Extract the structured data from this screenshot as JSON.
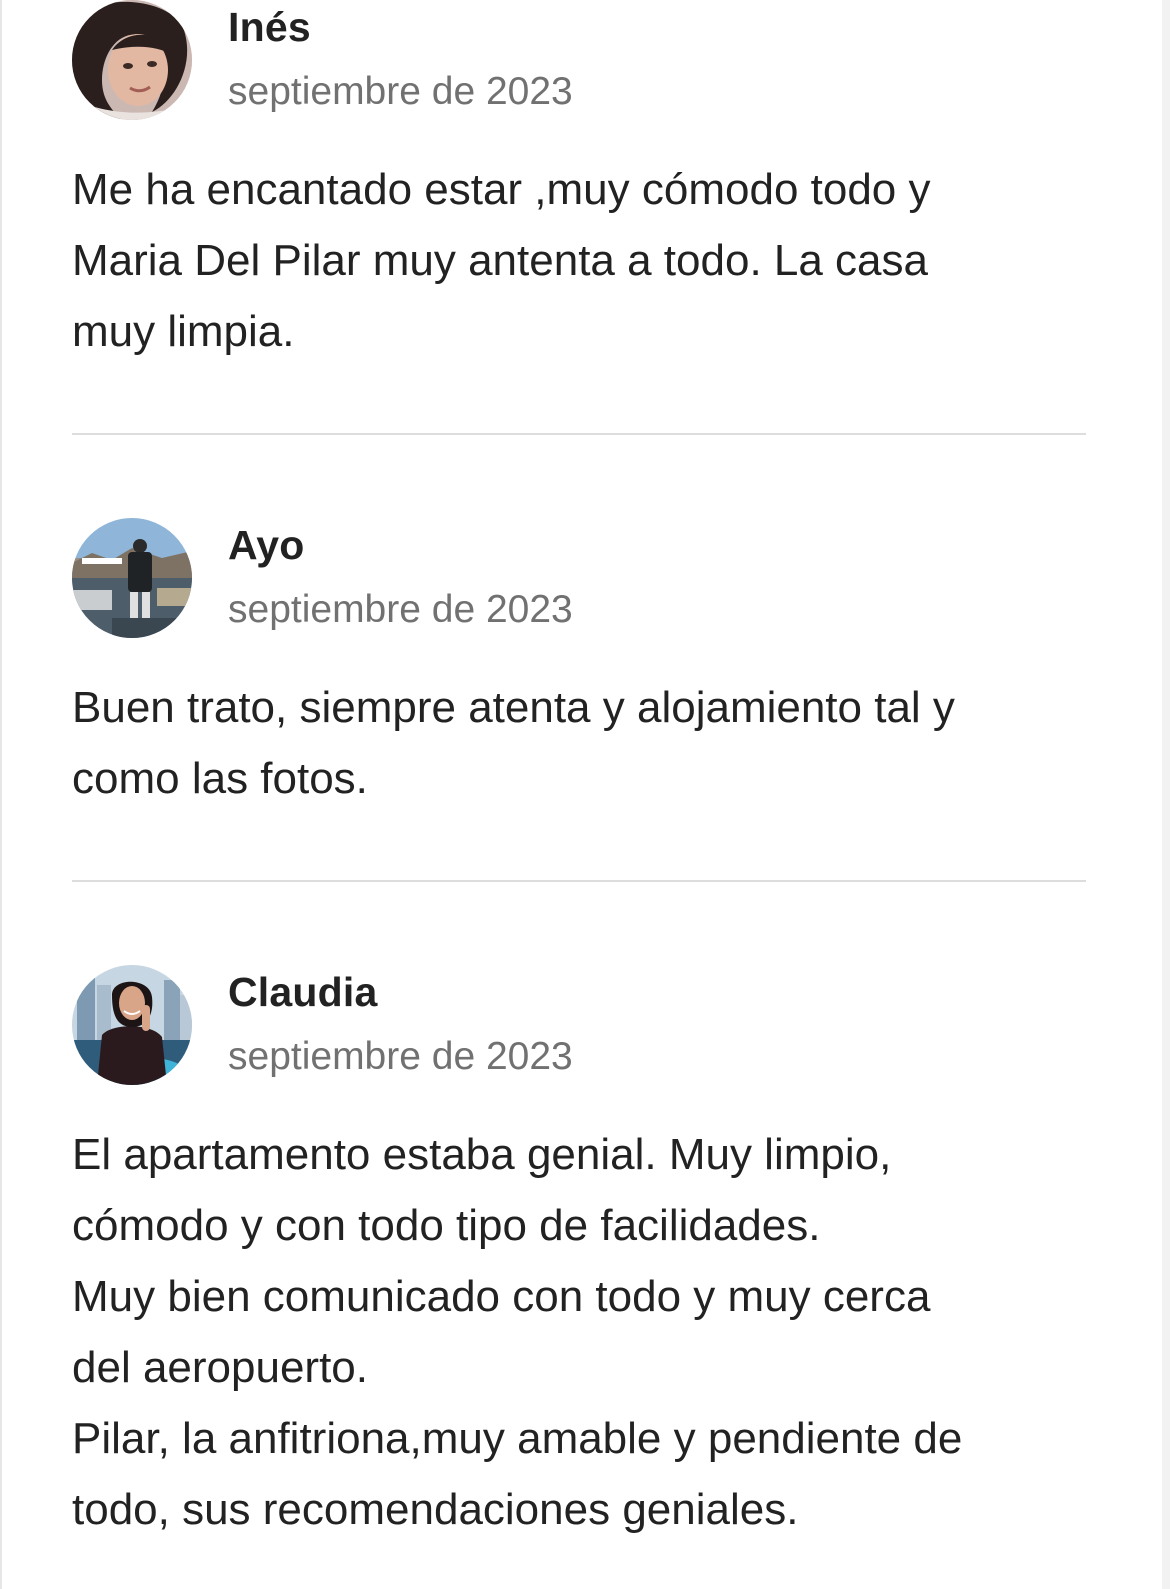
{
  "reviews": [
    {
      "name": "Inés",
      "date": "septiembre de 2023",
      "text": "Me ha encantado estar ,muy cómodo todo y\nMaria Del Pilar muy antenta a todo. La casa\nmuy limpia."
    },
    {
      "name": "Ayo",
      "date": "septiembre de 2023",
      "text": "Buen trato, siempre atenta y alojamiento tal y\ncomo las fotos."
    },
    {
      "name": "Claudia",
      "date": "septiembre de 2023",
      "text": "El apartamento estaba genial. Muy limpio,\ncómodo y con todo tipo de facilidades.\nMuy bien comunicado con todo y muy cerca\ndel aeropuerto.\nPilar, la anfitriona,muy amable y pendiente de\ntodo, sus recomendaciones geniales."
    }
  ]
}
